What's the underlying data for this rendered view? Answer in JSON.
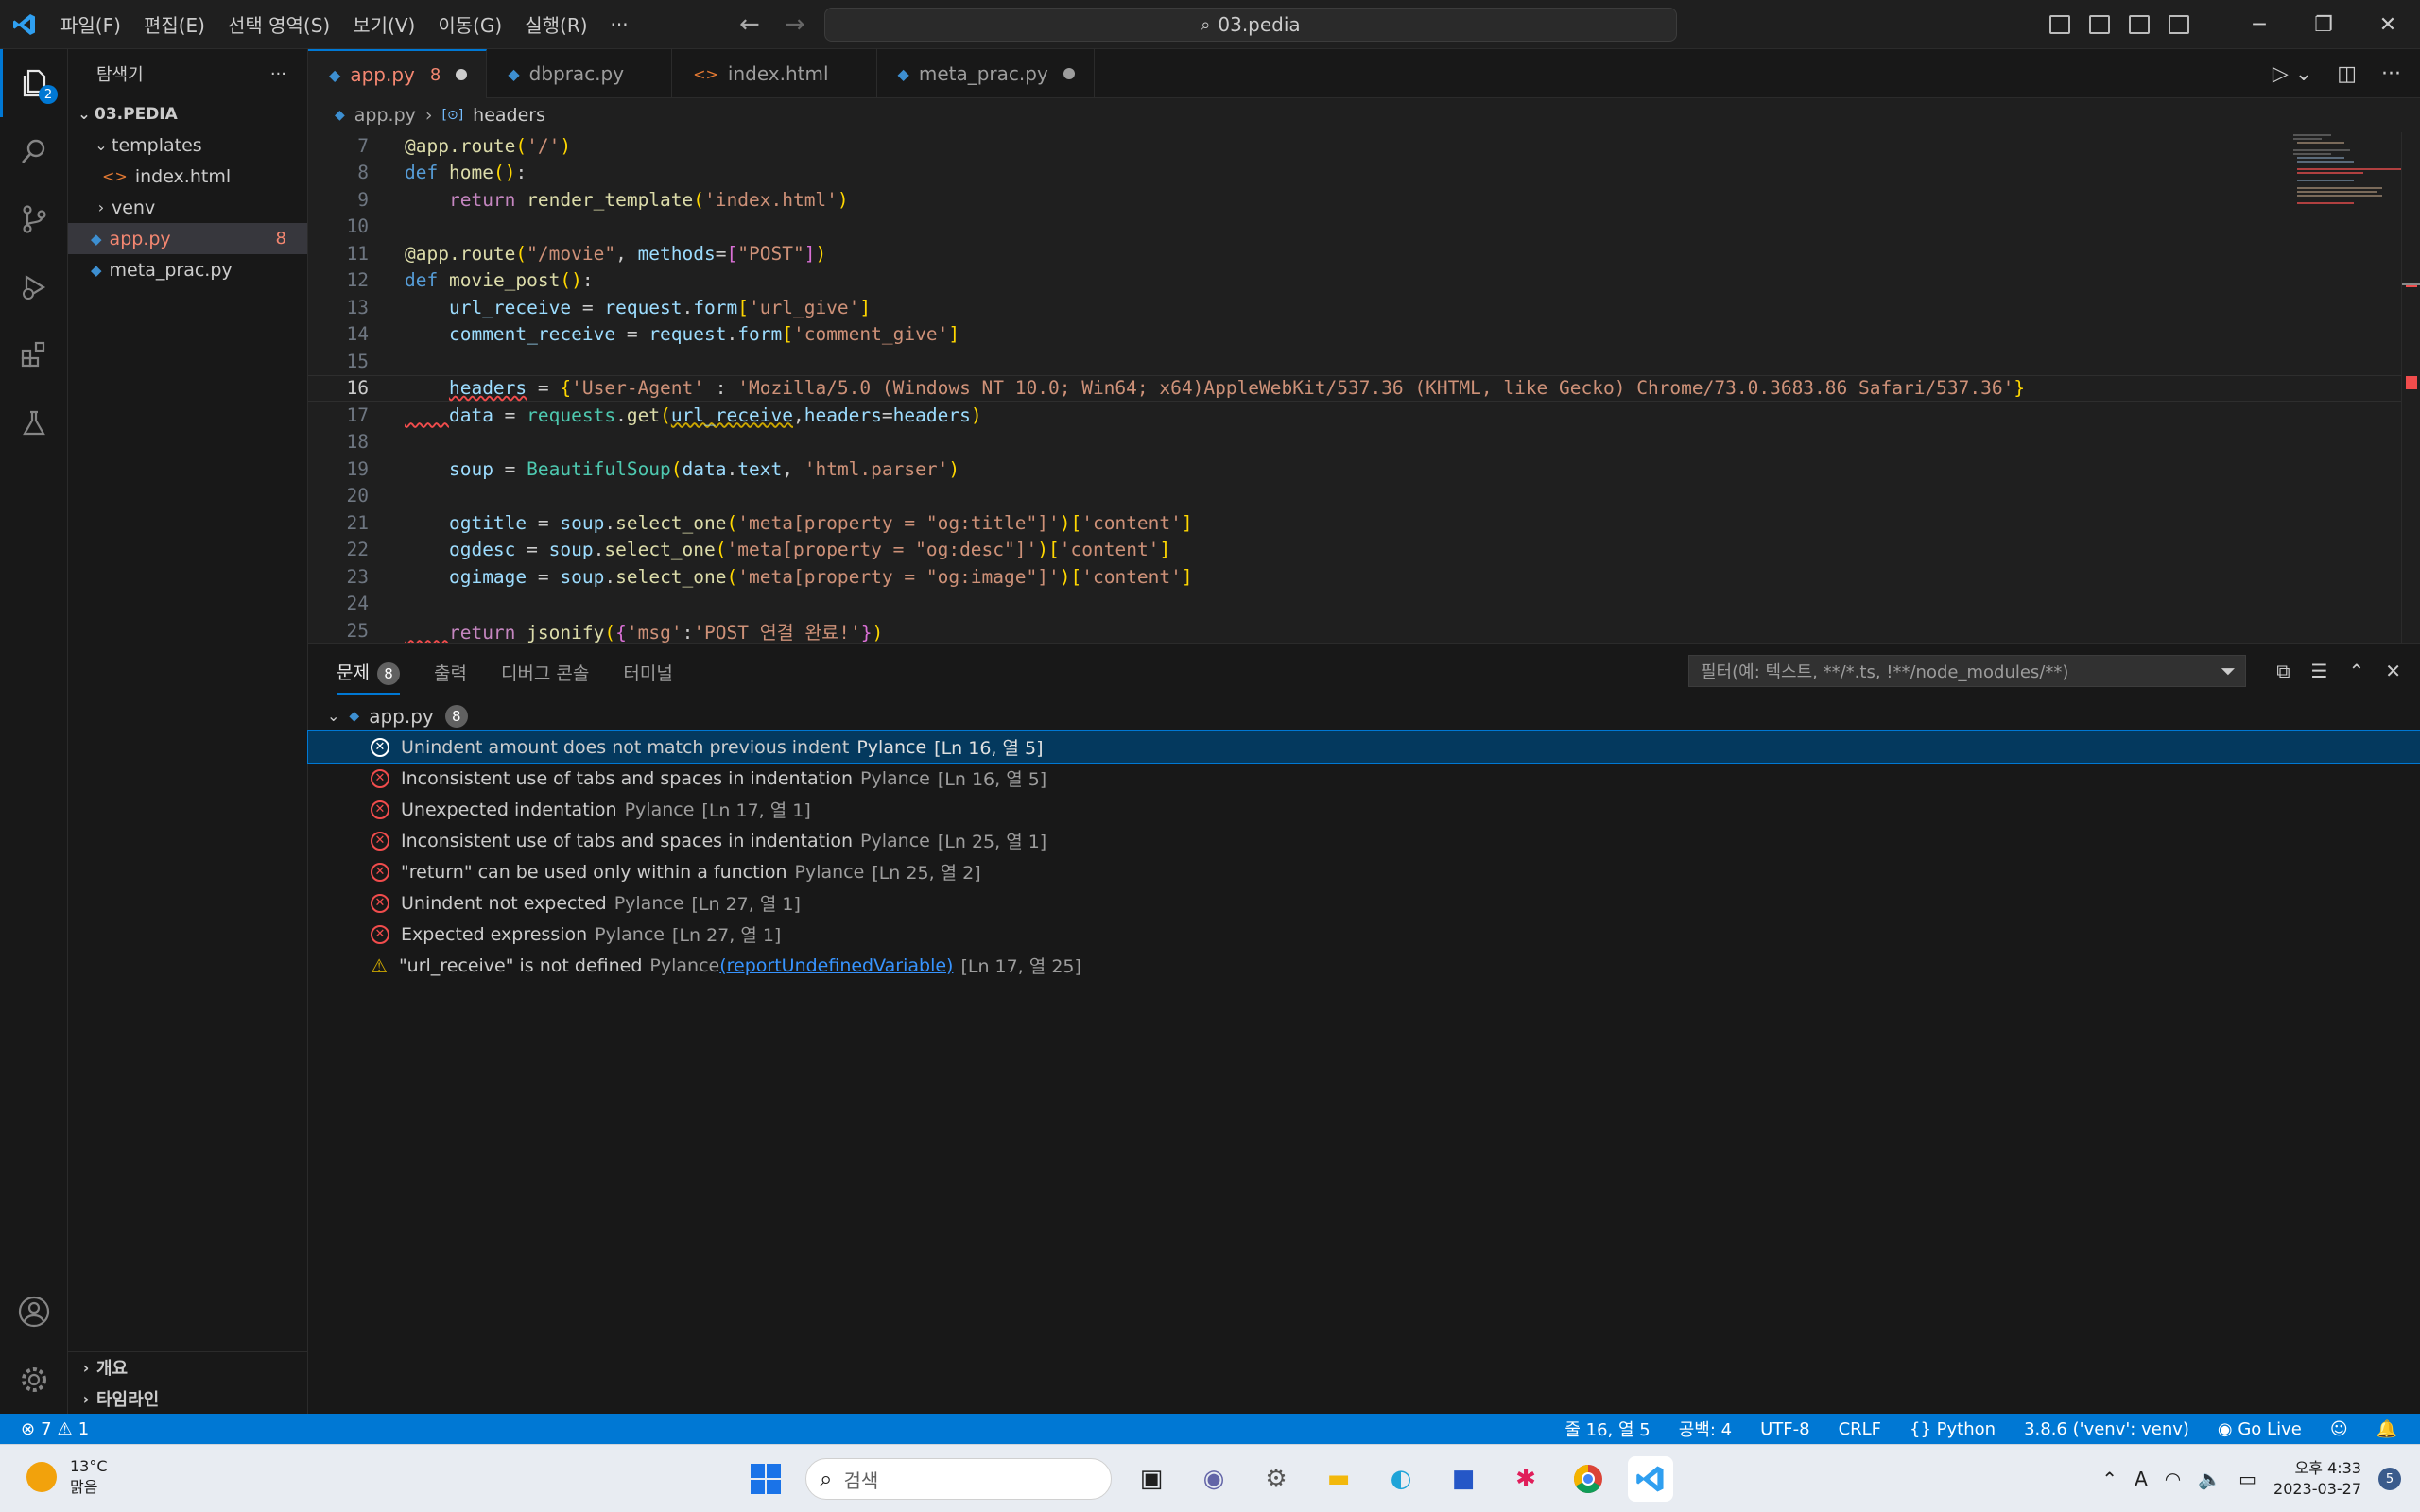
{
  "titlebar": {
    "menus": [
      "파일(F)",
      "편집(E)",
      "선택 영역(S)",
      "보기(V)",
      "이동(G)",
      "실행(R)",
      "···"
    ],
    "search": "03.pedia",
    "accent": "#0078d4"
  },
  "activity": {
    "explorer_badge": "2"
  },
  "sidebar": {
    "title": "탐색기",
    "more": "···",
    "root": "03.PEDIA",
    "items": [
      {
        "label": "templates",
        "type": "folder-open"
      },
      {
        "label": "index.html",
        "type": "html"
      },
      {
        "label": "venv",
        "type": "folder"
      },
      {
        "label": "app.py",
        "type": "py",
        "count": "8"
      },
      {
        "label": "meta_prac.py",
        "type": "py"
      }
    ],
    "outline": "개요",
    "timeline": "타임라인"
  },
  "tabs": [
    {
      "label": "app.py",
      "count": "8"
    },
    {
      "label": "dbprac.py"
    },
    {
      "label": "index.html"
    },
    {
      "label": "meta_prac.py"
    }
  ],
  "breadcrumb": {
    "file": "app.py",
    "symbol": "headers"
  },
  "code": {
    "line_numbers": [
      "7",
      "8",
      "9",
      "10",
      "11",
      "12",
      "13",
      "14",
      "15",
      "16",
      "17",
      "18",
      "19",
      "20",
      "21",
      "22",
      "23",
      "24",
      "25"
    ],
    "current_line": "16"
  },
  "panel": {
    "tabs": [
      "문제",
      "출력",
      "디버그 콘솔",
      "터미널"
    ],
    "problems_count": "8",
    "filter_placeholder": "필터(예: 텍스트, **/*.ts, !**/node_modules/**)",
    "file": "app.py",
    "file_count": "8",
    "problems": [
      {
        "sev": "error",
        "msg": "Unindent amount does not match previous indent",
        "src": "Pylance",
        "loc": "[Ln 16, 열 5]"
      },
      {
        "sev": "error",
        "msg": "Inconsistent use of tabs and spaces in indentation",
        "src": "Pylance",
        "loc": "[Ln 16, 열 5]"
      },
      {
        "sev": "error",
        "msg": "Unexpected indentation",
        "src": "Pylance",
        "loc": "[Ln 17, 열 1]"
      },
      {
        "sev": "error",
        "msg": "Inconsistent use of tabs and spaces in indentation",
        "src": "Pylance",
        "loc": "[Ln 25, 열 1]"
      },
      {
        "sev": "error",
        "msg": "\"return\" can be used only within a function",
        "src": "Pylance",
        "loc": "[Ln 25, 열 2]"
      },
      {
        "sev": "error",
        "msg": "Unindent not expected",
        "src": "Pylance",
        "loc": "[Ln 27, 열 1]"
      },
      {
        "sev": "error",
        "msg": "Expected expression",
        "src": "Pylance",
        "loc": "[Ln 27, 열 1]"
      },
      {
        "sev": "warning",
        "msg": "\"url_receive\" is not defined",
        "src": "Pylance",
        "link": "(reportUndefinedVariable)",
        "loc": "[Ln 17, 열 25]"
      }
    ]
  },
  "status": {
    "errors": "7",
    "warnings": "1",
    "position": "줄 16, 열 5",
    "spaces": "공백: 4",
    "encoding": "UTF-8",
    "eol": "CRLF",
    "language": "Python",
    "interpreter": "3.8.6 ('venv': venv)",
    "golive": "Go Live"
  },
  "taskbar": {
    "temp": "13°C",
    "weather": "맑음",
    "search": "검색",
    "time": "오후 4:33",
    "date": "2023-03-27",
    "notifications": "5"
  }
}
